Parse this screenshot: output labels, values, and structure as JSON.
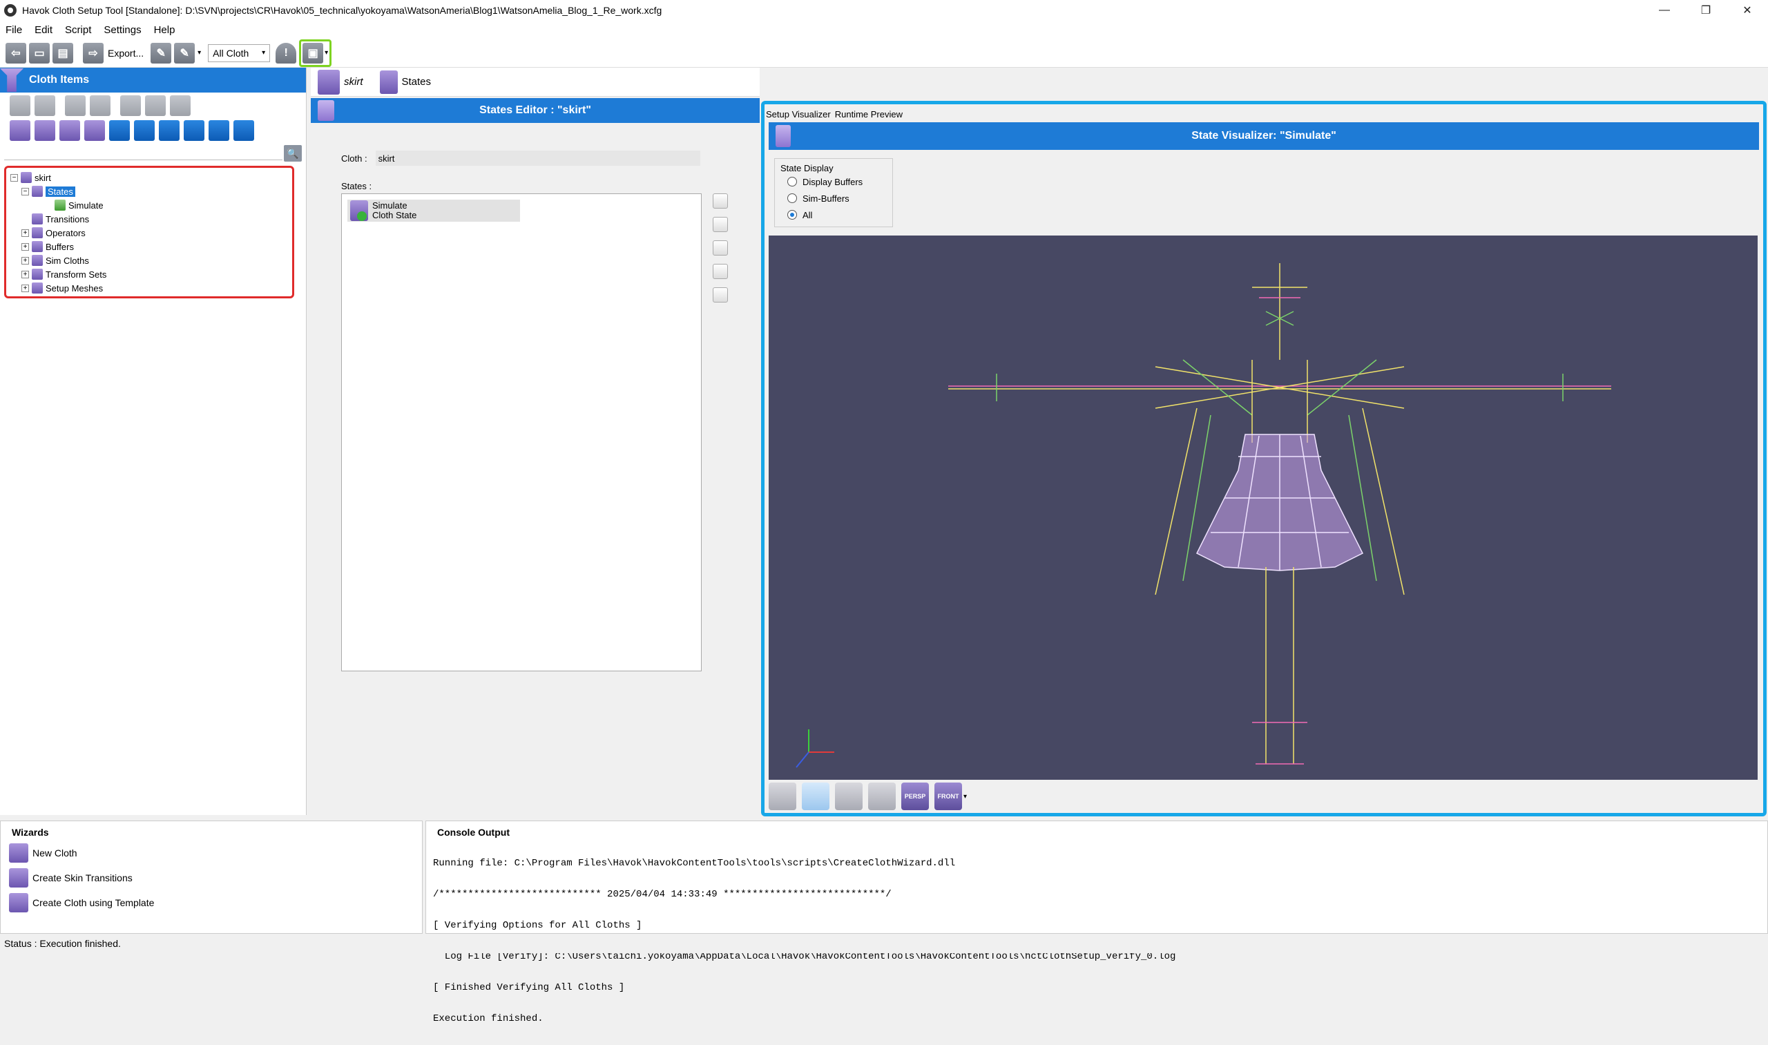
{
  "window": {
    "title": "Havok Cloth Setup Tool [Standalone]: D:\\SVN\\projects\\CR\\Havok\\05_technical\\yokoyama\\WatsonAmeria\\Blog1\\WatsonAmelia_Blog_1_Re_work.xcfg",
    "minimize": "—",
    "restore": "❐",
    "close": "✕"
  },
  "menu": [
    "File",
    "Edit",
    "Script",
    "Settings",
    "Help"
  ],
  "toolbar": {
    "export_label": "Export...",
    "cloth_filter": "All Cloth",
    "warning_symbol": "!"
  },
  "cloth_items": {
    "header": "Cloth Items",
    "search_symbol": "🔍",
    "tree": {
      "root": "skirt",
      "states": "States",
      "simulate": "Simulate",
      "transitions": "Transitions",
      "operators": "Operators",
      "buffers": "Buffers",
      "sim_cloths": "Sim Cloths",
      "transform_sets": "Transform Sets",
      "setup_meshes": "Setup Meshes"
    }
  },
  "middle": {
    "tabs": [
      "skirt",
      "States"
    ],
    "header": "States Editor : \"skirt\"",
    "cloth_label": "Cloth :",
    "cloth_value": "skirt",
    "states_label": "States :",
    "state_name": "Simulate",
    "state_type": "Cloth State"
  },
  "visualizer": {
    "tabs": [
      "Setup Visualizer",
      "Runtime Preview"
    ],
    "header": "State Visualizer: \"Simulate\"",
    "group_title": "State Display",
    "options": [
      "Display Buffers",
      "Sim-Buffers",
      "All"
    ],
    "selected_option": "All",
    "persp_label": "PERSP",
    "front_label": "FRONT",
    "background_color": "#474863"
  },
  "wizards": {
    "header": "Wizards",
    "items": [
      "New Cloth",
      "Create Skin Transitions",
      "Create Cloth using Template"
    ]
  },
  "console": {
    "header": "Console Output",
    "lines": [
      "Running file: C:\\Program Files\\Havok\\HavokContentTools\\tools\\scripts\\CreateClothWizard.dll",
      "/**************************** 2025/04/04 14:33:49 ****************************/",
      "[ Verifying Options for All Cloths ]",
      "  Log File [Verify]: C:\\Users\\taichi.yokoyama\\AppData\\Local\\Havok\\HavokContentTools\\HavokContentTools\\hctClothSetup_verify_0.log",
      "[ Finished Verifying All Cloths ]",
      "Execution finished."
    ]
  },
  "status": "Status : Execution finished."
}
